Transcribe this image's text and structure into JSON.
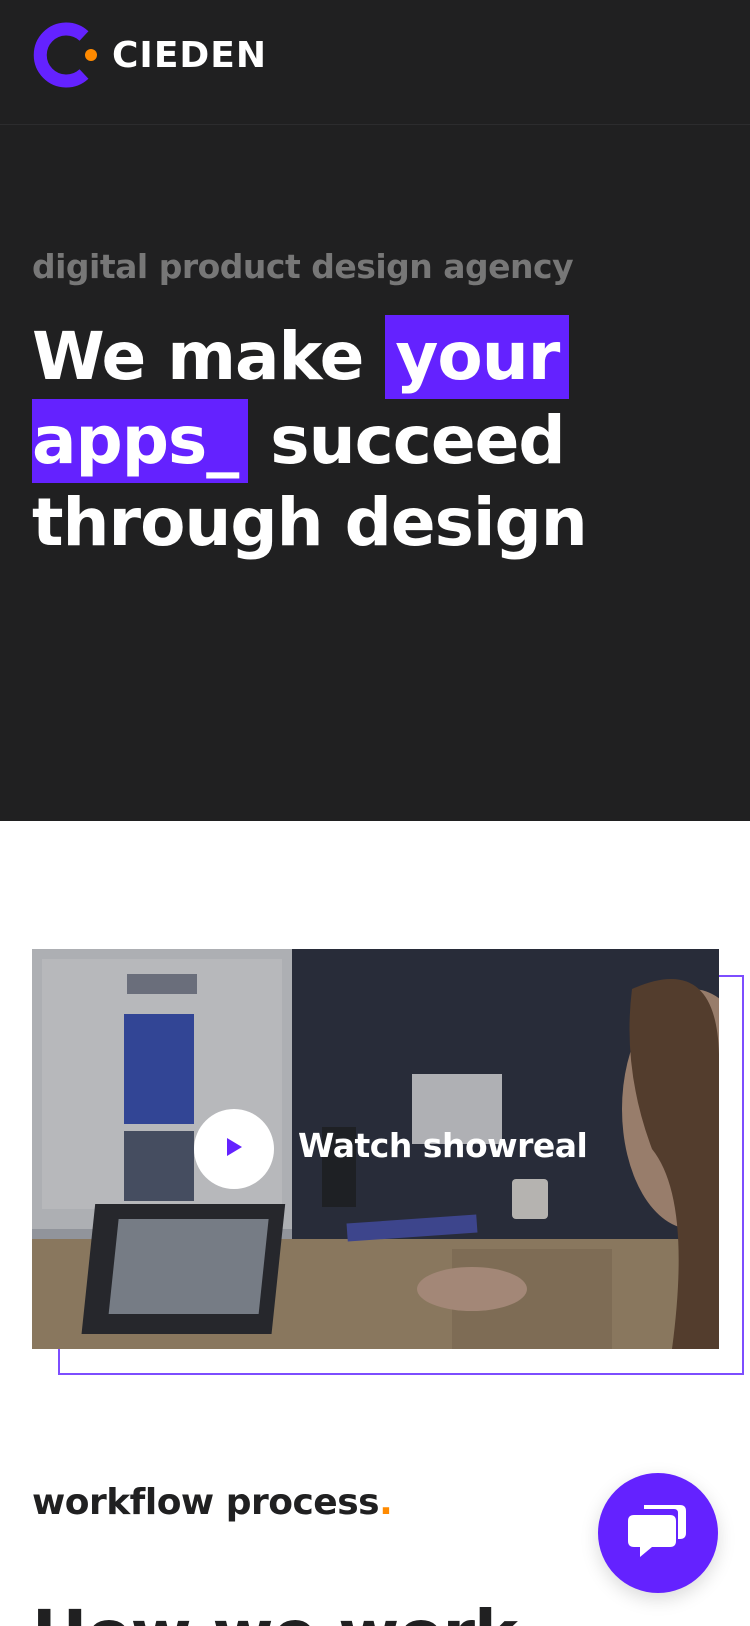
{
  "colors": {
    "accent": "#6422ff",
    "orange": "#ff8a00",
    "dark": "#202021",
    "white": "#ffffff",
    "muted": "#777777"
  },
  "header": {
    "logo_text": "CIEDEN",
    "logo_icon": "cieden-logo-icon"
  },
  "hero": {
    "tagline": "digital product design agency",
    "headline_1": "We make",
    "headline_hl_1": "your",
    "headline_hl_2": "apps_",
    "headline_2": "succeed",
    "headline_3": "through design"
  },
  "showreel": {
    "label": "Watch showreal",
    "play_icon": "play-icon"
  },
  "workflow": {
    "label": "workflow process",
    "dot": ".",
    "title": "How we work"
  },
  "chat": {
    "icon": "chat-bubble-icon"
  }
}
